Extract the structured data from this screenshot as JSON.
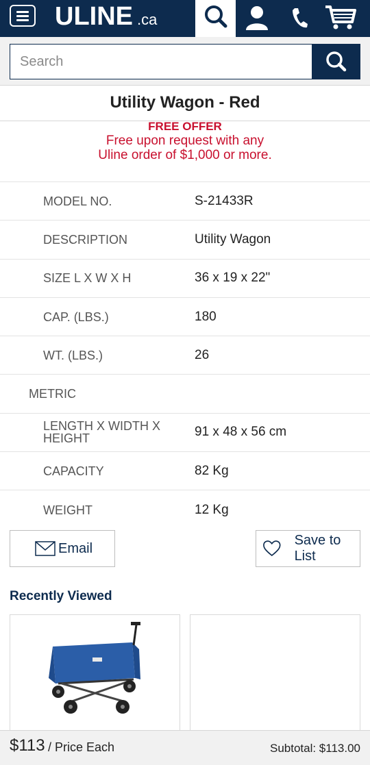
{
  "header": {
    "logo_main": "ULINE",
    "logo_sub": ".ca",
    "icons": [
      "menu-icon",
      "search-icon",
      "account-icon",
      "phone-icon",
      "cart-icon"
    ],
    "brand_color": "#0d2b4e"
  },
  "search": {
    "placeholder": "Search",
    "value": ""
  },
  "product": {
    "title": "Utility Wagon - Red",
    "offer": {
      "heading": "FREE OFFER",
      "line1": "Free upon request with any",
      "line2": "Uline order of $1,000 or more.",
      "color": "#c8102e"
    },
    "specs": [
      {
        "label": "MODEL NO.",
        "value": "S-21433R"
      },
      {
        "label": "DESCRIPTION",
        "value": "Utility Wagon"
      },
      {
        "label": "SIZE L X W X H",
        "value": "36 x 19 x 22\""
      },
      {
        "label": "CAP. (LBS.)",
        "value": "180"
      },
      {
        "label": "WT. (LBS.)",
        "value": "26"
      }
    ],
    "metric_heading": "METRIC",
    "metric_specs": [
      {
        "label": "LENGTH X WIDTH X HEIGHT",
        "value": "91 x 48 x 56 cm"
      },
      {
        "label": "CAPACITY",
        "value": "82 Kg"
      },
      {
        "label": "WEIGHT",
        "value": "12 Kg"
      }
    ]
  },
  "actions": {
    "email_label": "Email",
    "save_label": "Save to List"
  },
  "recently_viewed": {
    "title": "Recently Viewed",
    "items": [
      {
        "image": "blue-folding-wagon"
      },
      {
        "image": ""
      }
    ]
  },
  "price_bar": {
    "price": "$113",
    "unit": "/ Price Each",
    "subtotal": "Subtotal: $113.00"
  }
}
